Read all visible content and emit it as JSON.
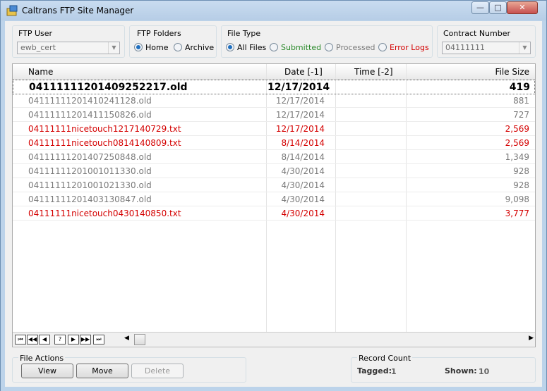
{
  "window": {
    "title": "Caltrans FTP Site Manager",
    "minimize": "—",
    "maximize": "□",
    "close": "✕"
  },
  "filters": {
    "ftp_user": {
      "label": "FTP User",
      "value": "ewb_cert"
    },
    "ftp_folders": {
      "label": "FTP Folders",
      "options": [
        "Home",
        "Archive"
      ],
      "selected": "Home"
    },
    "file_type": {
      "label": "File Type",
      "options": [
        "All Files",
        "Submitted",
        "Processed",
        "Error Logs"
      ],
      "selected": "All Files"
    },
    "contract_number": {
      "label": "Contract Number",
      "value": "04111111"
    }
  },
  "grid": {
    "columns": [
      "Name",
      "Date [-1]",
      "Time [-2]",
      "File Size"
    ],
    "rows": [
      {
        "name": "04111111201409252217.old",
        "date": "12/17/2014",
        "size": "419",
        "status": "selected"
      },
      {
        "name": "04111111201410241128.old",
        "date": "12/17/2014",
        "size": "881",
        "status": "normal"
      },
      {
        "name": "04111111201411150826.old",
        "date": "12/17/2014",
        "size": "727",
        "status": "normal"
      },
      {
        "name": "04111111nicetouch1217140729.txt",
        "date": "12/17/2014",
        "size": "2,569",
        "status": "error"
      },
      {
        "name": "04111111nicetouch0814140809.txt",
        "date": "8/14/2014",
        "size": "2,569",
        "status": "error"
      },
      {
        "name": "04111111201407250848.old",
        "date": "8/14/2014",
        "size": "1,349",
        "status": "normal"
      },
      {
        "name": "04111111201001011330.old",
        "date": "4/30/2014",
        "size": "928",
        "status": "normal"
      },
      {
        "name": "04111111201001021330.old",
        "date": "4/30/2014",
        "size": "928",
        "status": "normal"
      },
      {
        "name": "04111111201403130847.old",
        "date": "4/30/2014",
        "size": "9,098",
        "status": "normal"
      },
      {
        "name": "04111111nicetouch0430140850.txt",
        "date": "4/30/2014",
        "size": "3,777",
        "status": "error"
      }
    ],
    "nav_buttons": [
      "⏮",
      "◀◀",
      "◀",
      "?",
      "▶",
      "▶▶",
      "⏭"
    ]
  },
  "file_actions": {
    "label": "File Actions",
    "view": "View",
    "move": "Move",
    "delete": "Delete"
  },
  "record_count": {
    "label": "Record Count",
    "tagged_label": "Tagged:",
    "tagged_value": "1",
    "shown_label": "Shown:",
    "shown_value": "10"
  },
  "colors": {
    "submitted": "#2a8a2a",
    "error": "#d40000",
    "muted": "#7a7a7a"
  }
}
